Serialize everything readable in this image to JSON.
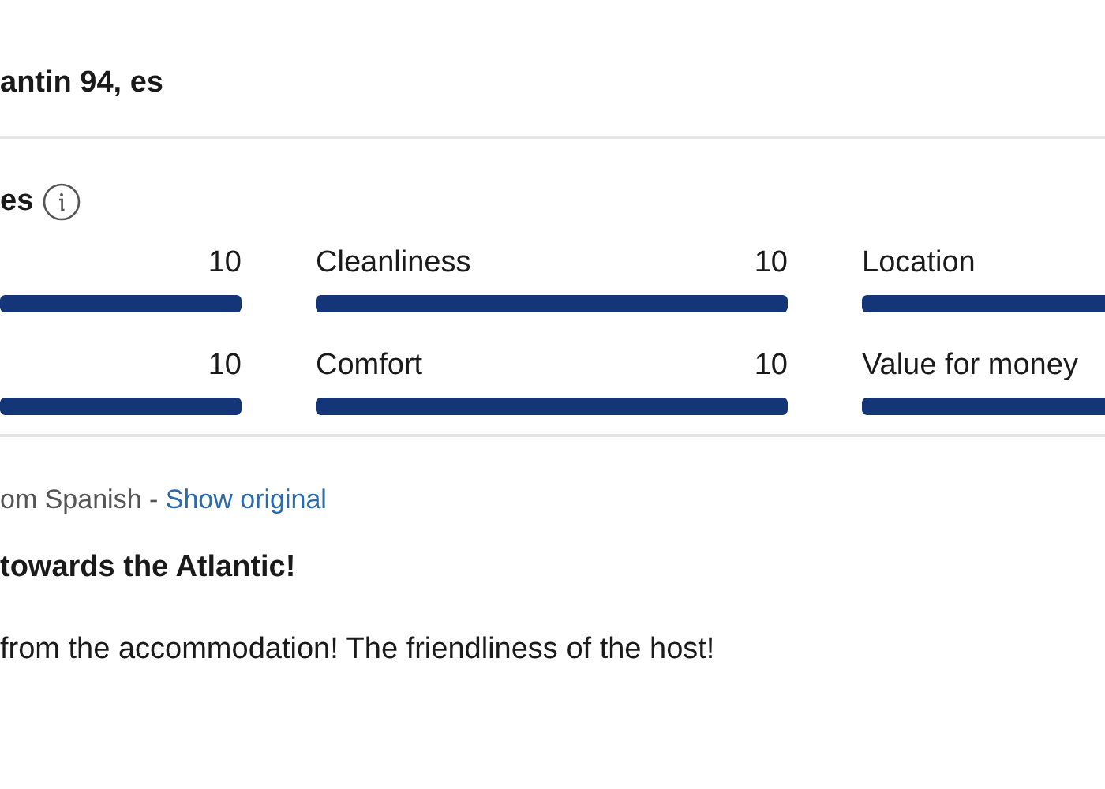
{
  "reviewer": {
    "name": "antin 94, es"
  },
  "scores": {
    "title": "es",
    "rows": [
      [
        {
          "score": "10",
          "level": 1
        },
        {
          "label": "Cleanliness",
          "score": "10",
          "level": 1
        },
        {
          "label": "Location",
          "level": 1
        }
      ],
      [
        {
          "score": "10",
          "level": 1
        },
        {
          "label": "Comfort",
          "score": "10",
          "level": 1
        },
        {
          "label": "Value for money",
          "level": 1
        }
      ]
    ]
  },
  "review": {
    "translated_note": "om Spanish - ",
    "show_original": "Show original",
    "title": "towards the Atlantic!",
    "body": "from the accommodation! The friendliness of the host!"
  }
}
